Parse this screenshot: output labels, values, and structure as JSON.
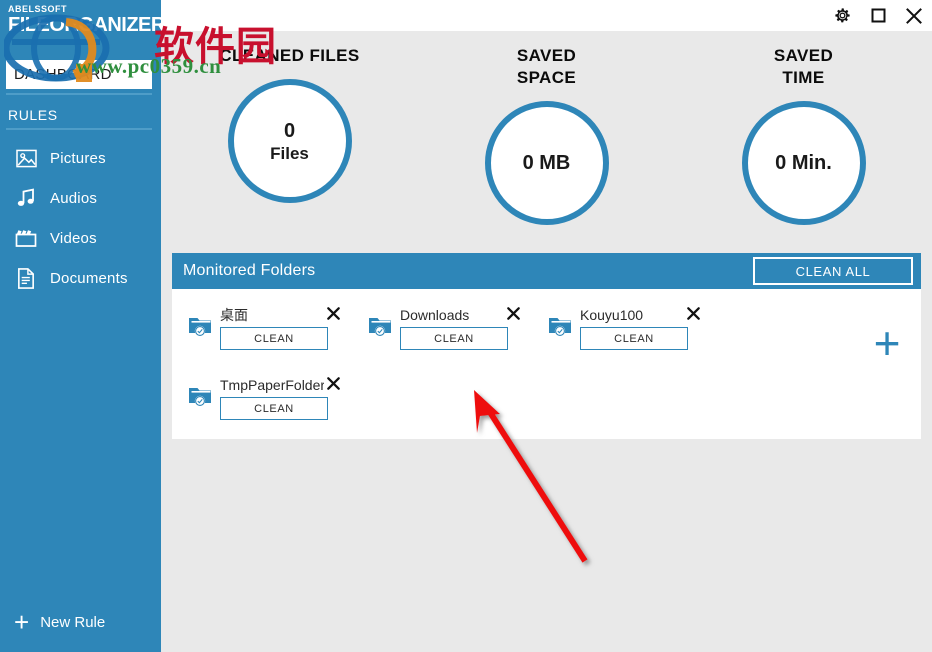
{
  "window": {
    "controls": [
      {
        "name": "settings-button",
        "icon": "gear-icon",
        "label": "Settings"
      },
      {
        "name": "maximize-button",
        "icon": "maximize-icon",
        "label": "Maximize"
      },
      {
        "name": "close-button",
        "icon": "close-icon",
        "label": "Close"
      }
    ]
  },
  "sidebar": {
    "brand": "ABELSSOFT",
    "product": "FILEORGANIZER",
    "active_item": "DASHBOARD",
    "section_label": "RULES",
    "items": [
      {
        "label": "Pictures",
        "icon": "picture-icon"
      },
      {
        "label": "Audios",
        "icon": "music-note-icon"
      },
      {
        "label": "Videos",
        "icon": "clapperboard-icon"
      },
      {
        "label": "Documents",
        "icon": "document-icon"
      }
    ],
    "new_rule": {
      "label": "New Rule",
      "icon": "plus-icon"
    }
  },
  "stats": [
    {
      "title": "CLEANED FILES",
      "value": "0",
      "unit": "Files"
    },
    {
      "title": "SAVED\nSPACE",
      "title_line1": "SAVED",
      "title_line2": "SPACE",
      "value": "0 MB",
      "unit": ""
    },
    {
      "title": "SAVED\nTIME",
      "title_line1": "SAVED",
      "title_line2": "TIME",
      "value": "0 Min.",
      "unit": ""
    }
  ],
  "panel": {
    "title": "Monitored Folders",
    "clean_all_label": "CLEAN ALL",
    "add_label": "+",
    "folders": [
      {
        "name": "桌面",
        "clean_label": "CLEAN",
        "remove_label": "✕",
        "icon": "folder-check-icon"
      },
      {
        "name": "Downloads",
        "clean_label": "CLEAN",
        "remove_label": "✕",
        "icon": "folder-check-icon"
      },
      {
        "name": "Kouyu100",
        "clean_label": "CLEAN",
        "remove_label": "✕",
        "icon": "folder-check-icon"
      },
      {
        "name": "TmpPaperFolder",
        "clean_label": "CLEAN",
        "remove_label": "✕",
        "icon": "folder-check-icon"
      }
    ]
  },
  "watermark": {
    "chinese": "软件园",
    "url": "www.pc0359.cn"
  },
  "colors": {
    "accent": "#2e86b8",
    "background": "#e9e9e9",
    "panel": "#ffffff",
    "text": "#1a1a1a",
    "watermark_red": "#c8102e",
    "watermark_green": "#2f8f3e",
    "annotation_arrow": "#ee1111"
  }
}
